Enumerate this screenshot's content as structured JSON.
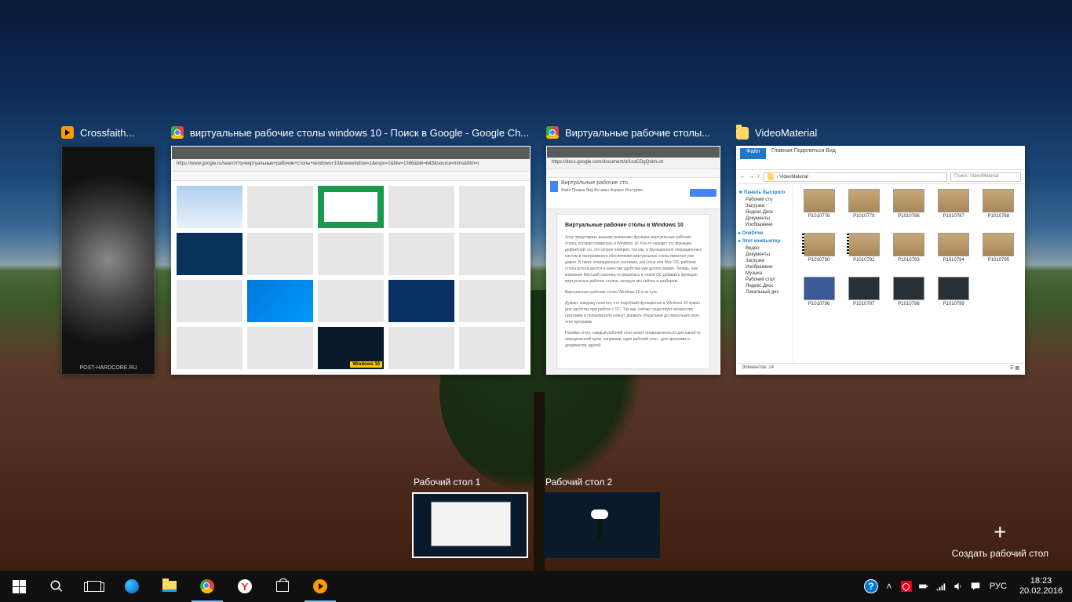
{
  "windows": {
    "aimp": {
      "title": "Crossfaith...",
      "footer": "POST-HARDCORE.RU"
    },
    "chrome1": {
      "title": "виртуальные рабочие столы windows 10 - Поиск в Google - Google Ch...",
      "url": "https://www.google.ru/search?q=виртуальные+рабочие+столы+windows+10&newwindow=1&espv=2&biw=1366&bih=643&source=lnms&tbm=i"
    },
    "chrome2": {
      "title": "Виртуальные рабочие столы...",
      "url": "https://docs.google.com/document/d/1cdCDgQxbn-ch",
      "doc_title": "Виртуальные рабочие сто...",
      "menus": "Файл  Правка  Вид  Вставка  Формат  Инструме",
      "heading": "Виртуальные рабочие столы в Windows 10",
      "p1": "Хочу представить вашему вниманию функцию виртуальные рабочие столы, которая появилась в Windows 10. Кто-то назовет эту функцию дефектной, но, это скорее неверно, так как, в функционале операционных систем и программного обеспечения виртуальные столы имеются уже давно. В таких операционных системах, как Linux или Mac OS, рабочие столы используются в качестве удобства уже долгое время. Теперь, уже компания Microsoft наконец-то решилась в новой ОС добавить функцию виртуальных рабочих столов, которую мы сейчас и разберем.",
      "p2": "Виртуальные рабочие столы Windows 10 и их суть",
      "p3": "Думаю, каждому понятно, что подобный функционал в Windows 10 нужен для удобства при работе с ОС. Так как, сейчас существует множество программ и пользователи начнут держать открытыми до нескольких окон этих программ.",
      "p4": "Помимо этого, каждый рабочий стол может предназначаться для какой-то определенной цели, например, один рабочий стол - для программ и документов, другой"
    },
    "explorer": {
      "title": "VideoMaterial",
      "ribbon_file": "Файл",
      "ribbon_tabs": "Главная   Поделиться   Вид",
      "crumb": "› VideoMaterial",
      "search_ph": "Поиск: VideoMaterial",
      "nav_quick": "Панель быстрого",
      "nav_items1": [
        "Рабочий сто",
        "Загрузки",
        "Яндекс.Диск",
        "Документы",
        "Изображени"
      ],
      "nav_onedrive": "OneDrive",
      "nav_pc": "Этот компьютер",
      "nav_items2": [
        "Видео",
        "Документы",
        "Загрузки",
        "Изображени",
        "Музыка",
        "Рабочий стол",
        "Яндекс.Диск",
        "Локальный дис"
      ],
      "files": [
        "P1010778",
        "P1010779",
        "P1010786",
        "P1010787",
        "P1010788",
        "P1010790",
        "P1010792",
        "P1010793",
        "P1010794",
        "P1010795",
        "P1010796",
        "P1010797",
        "P1010798",
        "P1010799"
      ],
      "status": "Элементов: 14"
    }
  },
  "desktops": {
    "d1": "Рабочий стол 1",
    "d2": "Рабочий стол 2"
  },
  "new_desktop": {
    "plus": "+",
    "label": "Создать рабочий стол"
  },
  "tray": {
    "lang": "РУС",
    "time": "18:23",
    "date": "20.02.2016",
    "help": "?",
    "chevron": "˄"
  },
  "yandex_letter": "Y"
}
